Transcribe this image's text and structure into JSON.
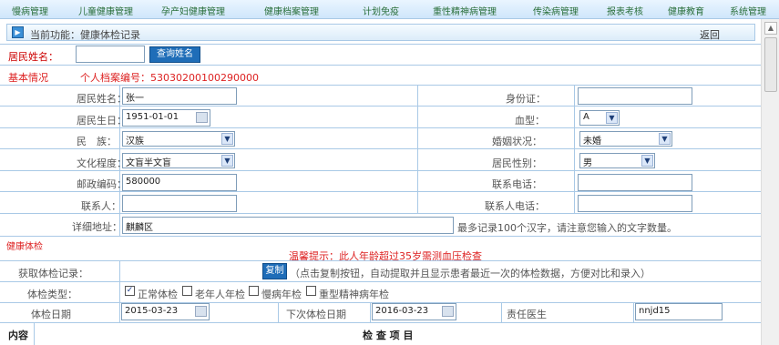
{
  "nav": [
    "慢病管理",
    "儿童健康管理",
    "孕产妇健康管理",
    "健康档案管理",
    "计划免疫",
    "重性精神病管理",
    "传染病管理",
    "报表考核",
    "健康教育",
    "系统管理"
  ],
  "funcbar": {
    "text": "当前功能：健康体检记录",
    "back": "返回"
  },
  "search": {
    "label": "居民姓名：",
    "value": "",
    "button": "查询姓名"
  },
  "basic": {
    "title": "基本情况",
    "archive_label": "个人档案编号：53030200100290000"
  },
  "fields": {
    "name_label": "居民姓名：",
    "name_value": "张一",
    "idcard_label": "身份证：",
    "idcard_value": "",
    "birth_label": "居民生日：",
    "birth_value": "1951-01-01",
    "blood_label": "血型：",
    "blood_value": "A",
    "nation_label": "民　族：",
    "nation_value": "汉族",
    "marital_label": "婚姻状况：",
    "marital_value": "未婚",
    "edu_label": "文化程度：",
    "edu_value": "文盲半文盲",
    "sex_label": "居民性别：",
    "sex_value": "男",
    "post_label": "邮政编码：",
    "post_value": "580000",
    "phone_label": "联系电话：",
    "phone_value": "",
    "contact_label": "联系人：",
    "contact_value": "",
    "cphone_label": "联系人电话：",
    "cphone_value": "",
    "addr_label": "详细地址：",
    "addr_value": "麒麟区",
    "addr_hint": "最多记录100个汉字，请注意您输入的文字数量。"
  },
  "exam": {
    "title": "健康体检",
    "tip": "温馨提示：此人年龄超过35岁需测血压检查",
    "get_label": "获取体检记录：",
    "copy_btn": "复制",
    "copy_hint": "（点击复制按钮，自动提取并且显示患者最近一次的体检数据，方便对比和录入）",
    "type_label": "体检类型：",
    "types": [
      {
        "label": "正常体检",
        "checked": true
      },
      {
        "label": "老年人年检",
        "checked": false
      },
      {
        "label": "慢病年检",
        "checked": false
      },
      {
        "label": "重型精神病年检",
        "checked": false
      }
    ],
    "date_label": "体检日期",
    "date_value": "2015-03-23",
    "next_label": "下次体检日期",
    "next_value": "2016-03-23",
    "doctor_label": "责任医生",
    "doctor_value": "nnjd15"
  },
  "table_header": {
    "content": "内容",
    "items": "检 查 项 目"
  }
}
